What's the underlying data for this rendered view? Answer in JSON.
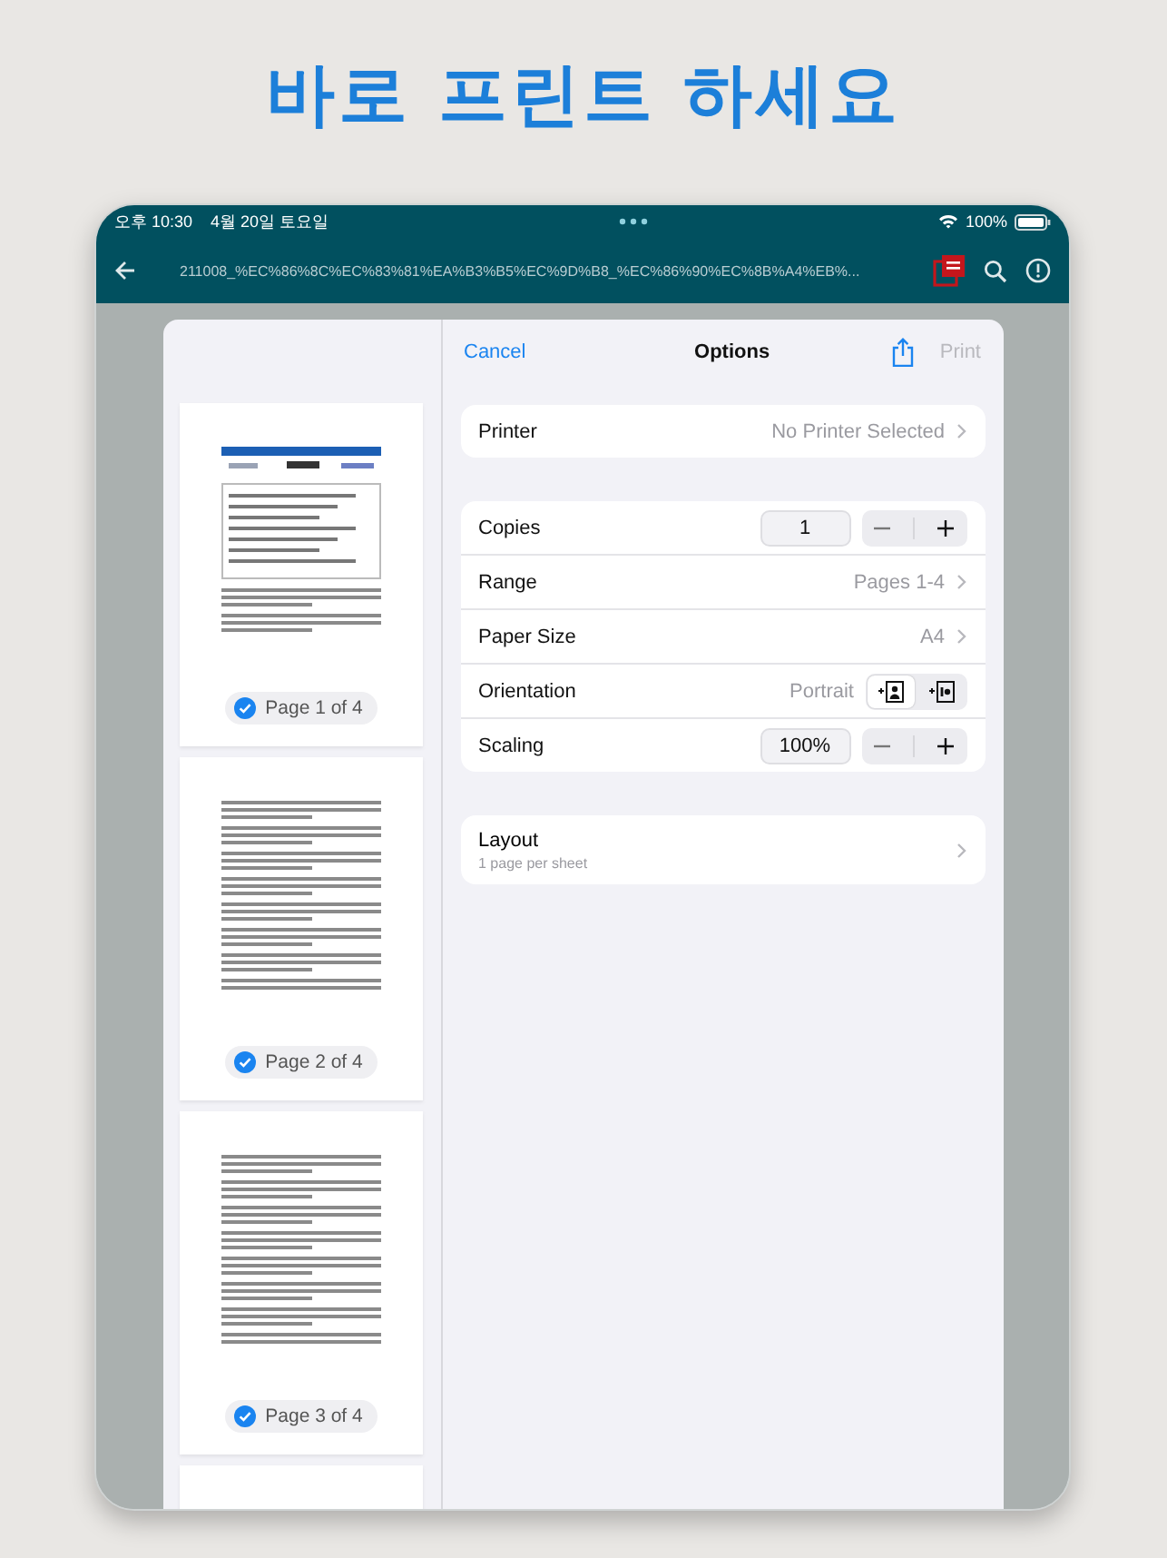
{
  "headline": "바로 프린트 하세요",
  "status_bar": {
    "time": "오후 10:30",
    "date": "4월 20일 토요일",
    "battery": "100%"
  },
  "toolbar": {
    "title": "211008_%EC%86%8C%EC%83%81%EA%B3%B5%EC%9D%B8_%EC%86%90%EC%8B%A4%EB%..."
  },
  "print_options": {
    "cancel": "Cancel",
    "title": "Options",
    "print": {
      "label": "Print",
      "disabled": true
    },
    "printer": {
      "label": "Printer",
      "value": "No Printer Selected"
    },
    "settings": [
      {
        "kind": "stepper",
        "label": "Copies",
        "value": "1"
      },
      {
        "kind": "link",
        "label": "Range",
        "value": "Pages 1-4"
      },
      {
        "kind": "link",
        "label": "Paper Size",
        "value": "A4"
      },
      {
        "kind": "orientation",
        "label": "Orientation",
        "value": "Portrait",
        "options": [
          {
            "selected": true
          },
          {
            "selected": false
          }
        ]
      },
      {
        "kind": "stepper",
        "label": "Scaling",
        "value": "100%"
      }
    ],
    "layout": {
      "label": "Layout",
      "detail": "1 page per sheet"
    }
  },
  "pages": [
    {
      "label": "Page 1 of 4",
      "checked": true
    },
    {
      "label": "Page 2 of 4",
      "checked": true
    },
    {
      "label": "Page 3 of 4",
      "checked": true
    }
  ]
}
